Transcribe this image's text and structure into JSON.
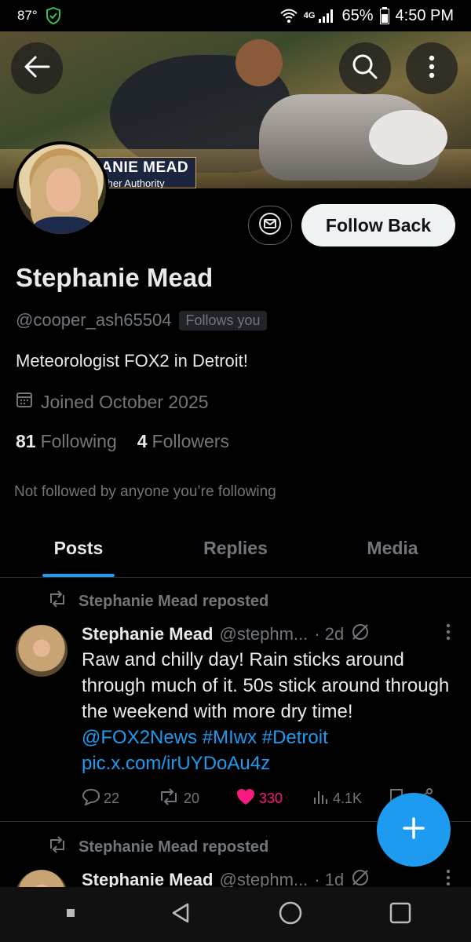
{
  "status_bar": {
    "temperature": "87°",
    "network": "4G",
    "battery": "65%",
    "time": "4:50 PM"
  },
  "banner": {
    "lower_third_name": "ANIE MEAD",
    "lower_third_sub": "ther Authority"
  },
  "profile": {
    "name": "Stephanie Mead",
    "handle": "@cooper_ash65504",
    "follows_you": "Follows you",
    "bio": "Meteorologist FOX2 in Detroit!",
    "joined": "Joined October 2025",
    "following_count": "81",
    "following_label": "Following",
    "followers_count": "4",
    "followers_label": "Followers",
    "not_followed": "Not followed by anyone you’re following",
    "follow_back_label": "Follow Back"
  },
  "tabs": [
    {
      "label": "Posts",
      "active": true
    },
    {
      "label": "Replies",
      "active": false
    },
    {
      "label": "Media",
      "active": false
    }
  ],
  "posts": [
    {
      "repost_label": "Stephanie Mead reposted",
      "author": "Stephanie Mead",
      "handle": "@stephm...",
      "age": "· 2d",
      "text": "Raw and chilly day! Rain sticks around through much of it. 50s stick around through the weekend with more dry time!",
      "links": "@FOX2News #MIwx #Detroit pic.x.com/irUYDoAu4z",
      "replies": "22",
      "reposts": "20",
      "likes": "330",
      "views": "4.1K"
    },
    {
      "repost_label": "Stephanie Mead reposted",
      "author": "Stephanie Mead",
      "handle": "@stephm...",
      "age": "· 1d"
    }
  ],
  "colors": {
    "accent": "#1d9bf0",
    "like": "#f91880",
    "muted": "#71767b",
    "text": "#e7e9ea"
  }
}
